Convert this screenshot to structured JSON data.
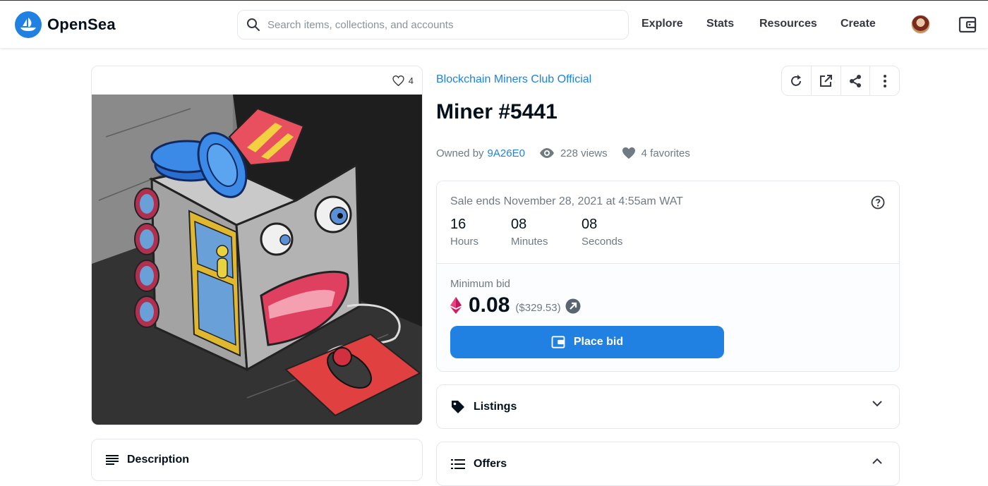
{
  "header": {
    "brand": "OpenSea",
    "search_placeholder": "Search items, collections, and accounts",
    "nav": [
      "Explore",
      "Stats",
      "Resources",
      "Create"
    ]
  },
  "asset": {
    "favorite_count": "4",
    "collection": "Blockchain Miners Club Official",
    "title": "Miner #5441",
    "owned_by_label": "Owned by",
    "owner": "9A26E0",
    "views": "228 views",
    "favorites": "4 favorites"
  },
  "sale": {
    "ends_text": "Sale ends November 28, 2021 at 4:55am WAT",
    "timer": [
      {
        "value": "16",
        "label": "Hours"
      },
      {
        "value": "08",
        "label": "Minutes"
      },
      {
        "value": "08",
        "label": "Seconds"
      }
    ],
    "min_bid_label": "Minimum bid",
    "price": "0.08",
    "price_usd": "($329.53)",
    "bid_button": "Place bid"
  },
  "panels": {
    "listings": "Listings",
    "offers": "Offers",
    "description": "Description"
  },
  "colors": {
    "accent": "#2081e2",
    "text_dark": "#04111d",
    "text_muted": "#707a83"
  }
}
